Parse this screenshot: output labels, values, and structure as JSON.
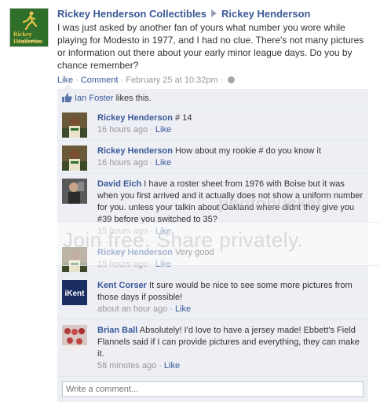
{
  "post": {
    "page_name": "Rickey Henderson Collectibles",
    "target_name": "Rickey Henderson",
    "text": "I was just asked by another fan of yours what number you wore while playing for Modesto in 1977, and I had no clue. There's not many pictures or information out there about your early minor league days. Do you by chance remember?",
    "avatar_logo_top": "Rickey Henderson",
    "avatar_logo_bottom": "Collectibles",
    "like_label": "Like",
    "comment_label": "Comment",
    "timestamp": "February 25 at 10:32pm",
    "dot": "·"
  },
  "likes": {
    "name": "Ian Foster",
    "suffix": " likes this."
  },
  "comments": [
    {
      "author": "Rickey Henderson",
      "text": " # 14",
      "time": "16 hours ago",
      "like": "Like",
      "avatar": "rickey"
    },
    {
      "author": "Rickey Henderson",
      "text": " How about my rookie # do you know it",
      "time": "16 hours ago",
      "like": "Like",
      "avatar": "rickey"
    },
    {
      "author": "David Eich",
      "text": " I have a roster sheet from 1976 with Boise but it was when you first arrived and it actually does not show a uniform number for you. unless your talkin about Oakland where didnt they give you #39 before you switched to 35?",
      "time": "15 hours ago",
      "like": "Like",
      "avatar": "david"
    },
    {
      "author": "Rickey Henderson",
      "text": " Very good",
      "time": "15 hours ago",
      "like": "Like",
      "avatar": "rickey"
    },
    {
      "author": "Kent Corser",
      "text": " It sure would be nice to see some more pictures from those days if possible!",
      "time": "about an hour ago",
      "like": "Like",
      "avatar": "kent",
      "avatar_text": "iKent"
    },
    {
      "author": "Brian Ball",
      "text": " Absolutely! I'd love to have a jersey made! Ebbett's Field Flannels said if I can provide pictures and everything, they can make it.",
      "time": "58 minutes ago",
      "like": "Like",
      "avatar": "brian"
    }
  ],
  "write_comment": {
    "placeholder": "Write a comment..."
  },
  "watermark": {
    "text": "Join free. Share privately.",
    "logo": "photobucket"
  },
  "colors": {
    "link": "#3b5998",
    "ufi_bg": "#edeff4",
    "meta": "#999999"
  }
}
